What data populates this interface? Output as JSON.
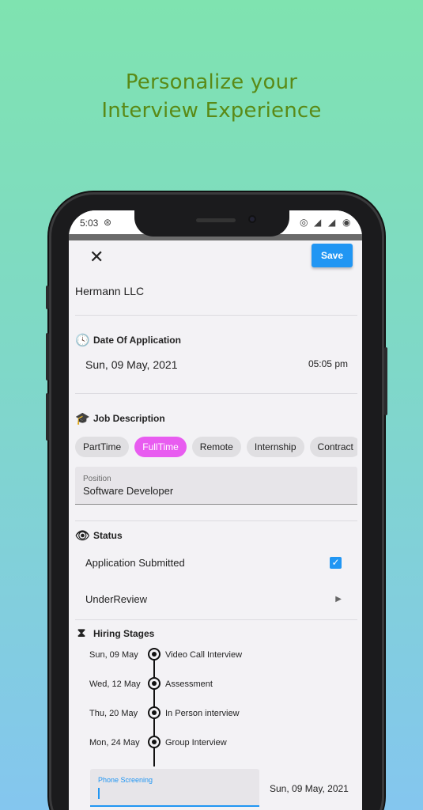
{
  "headline": {
    "line1": "Personalize your",
    "line2": "Interview Experience"
  },
  "status_bar": {
    "time": "5:03"
  },
  "toolbar": {
    "save_label": "Save"
  },
  "company": "Hermann LLC",
  "date_section": {
    "title": "Date Of Application",
    "date": "Sun, 09 May, 2021",
    "time": "05:05 pm"
  },
  "job_section": {
    "title": "Job Description",
    "chips": [
      "PartTime",
      "FullTime",
      "Remote",
      "Internship",
      "Contract"
    ],
    "selected_chip": "FullTime",
    "position_label": "Position",
    "position_value": "Software Developer"
  },
  "status_section": {
    "title": "Status",
    "submitted_label": "Application Submitted",
    "submitted_checked": true,
    "review_label": "UnderReview"
  },
  "hiring_section": {
    "title": "Hiring Stages",
    "stages": [
      {
        "date": "Sun, 09 May",
        "name": "Video Call Interview"
      },
      {
        "date": "Wed, 12 May",
        "name": "Assessment"
      },
      {
        "date": "Thu, 20 May",
        "name": "In Person interview"
      },
      {
        "date": "Mon, 24 May",
        "name": "Group Interview"
      }
    ],
    "new_stage_placeholder": "Phone Screening",
    "new_stage_date": "Sun, 09 May, 2021"
  },
  "colors": {
    "accent": "#2196f3",
    "chip_selected": "#e85cf0",
    "headline": "#5a8a16"
  }
}
